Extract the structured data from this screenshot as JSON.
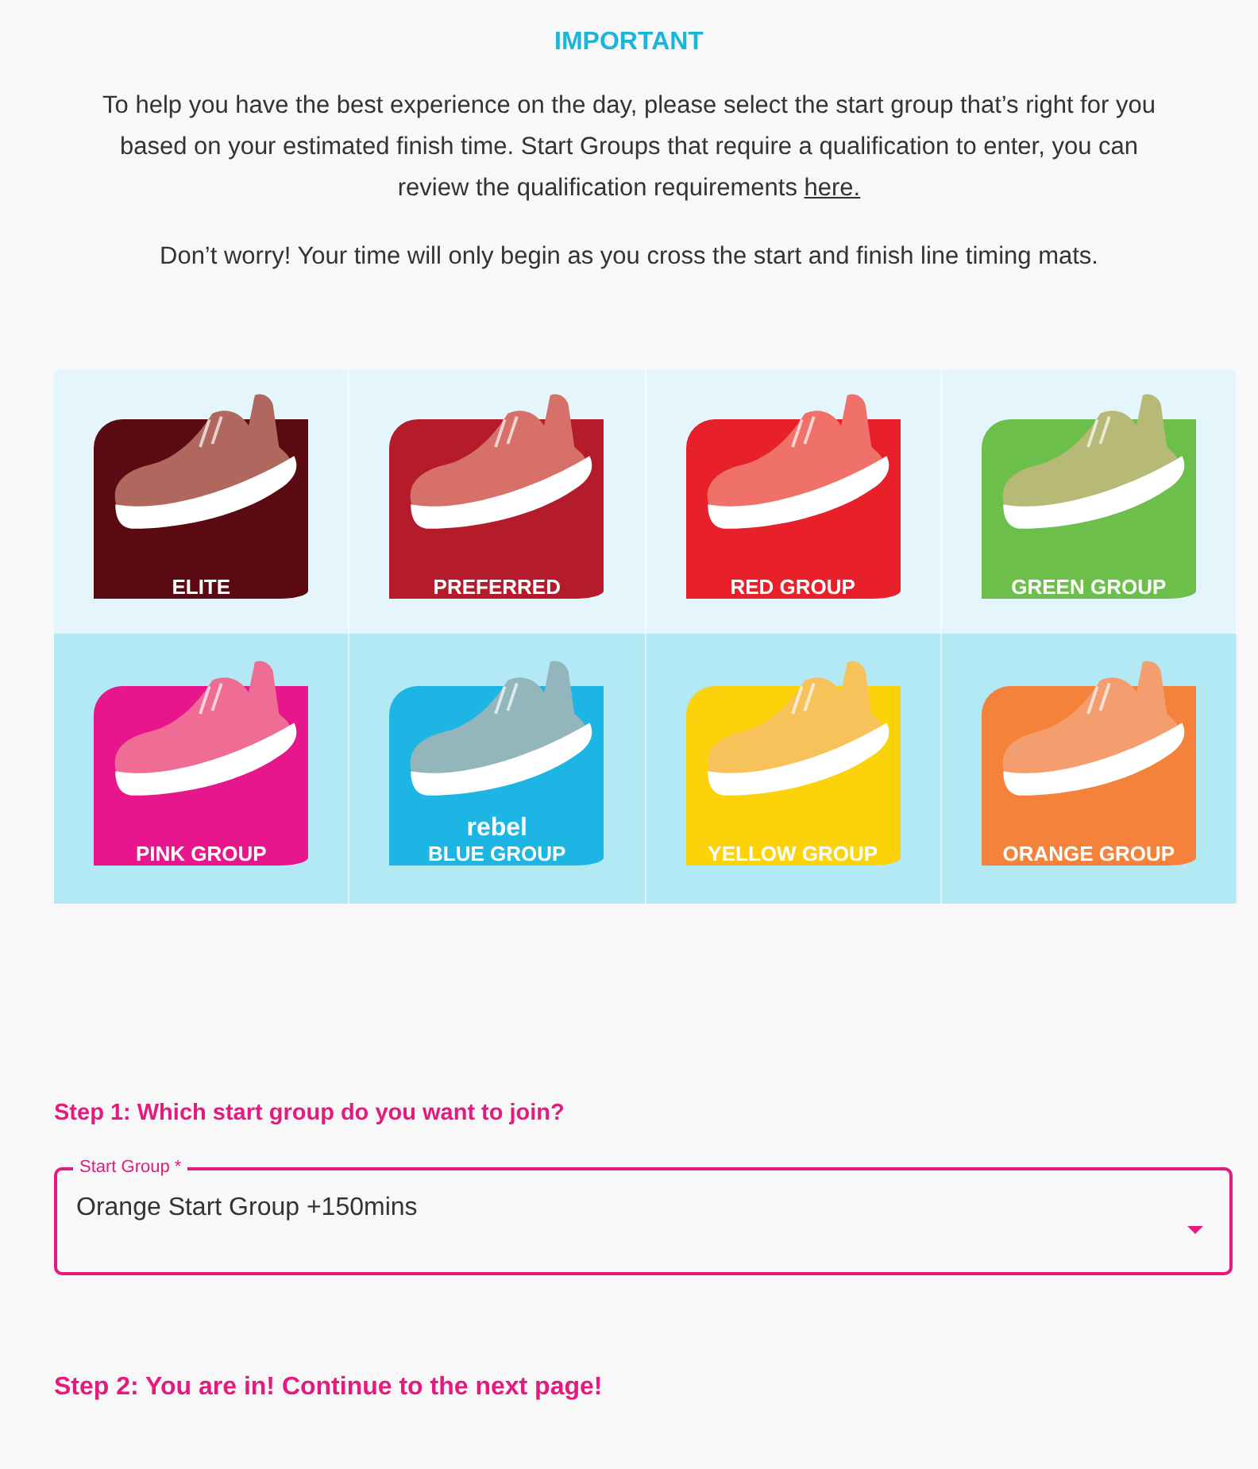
{
  "notice": {
    "heading": "IMPORTANT",
    "paragraphs": [
      {
        "text": "To help you have the best experience on the day, please select the start group that’s right for you based on your estimated finish time. Start Groups that require a qualification to enter, you can review the qualification requirements ",
        "link": "here."
      },
      {
        "text": "Don’t worry! Your time will only begin as you cross the start and finish line timing mats."
      }
    ]
  },
  "start_group_rows": [
    {
      "tiles": [
        {
          "label": "ELITE",
          "color": "#5c0a12"
        },
        {
          "label": "PREFERRED",
          "color": "#b41c2b"
        },
        {
          "label": "RED GROUP",
          "color": "#e8202a"
        },
        {
          "label": "GREEN GROUP",
          "color": "#6cbf4a"
        }
      ]
    },
    {
      "tiles": [
        {
          "label": "PINK GROUP",
          "color": "#e8168c"
        },
        {
          "label": "BLUE GROUP",
          "color": "#1db6e4",
          "brand": "rebel"
        },
        {
          "label": "YELLOW GROUP",
          "color": "#fcd20a"
        },
        {
          "label": "ORANGE GROUP",
          "color": "#f5823a"
        }
      ]
    }
  ],
  "step1": {
    "title": "Step 1: Which start group do you want to join?",
    "field": {
      "label": "Start Group *",
      "value": "Orange Start Group +150mins"
    }
  },
  "step2": {
    "title": "Step 2: You are in! Continue to the next page!"
  }
}
